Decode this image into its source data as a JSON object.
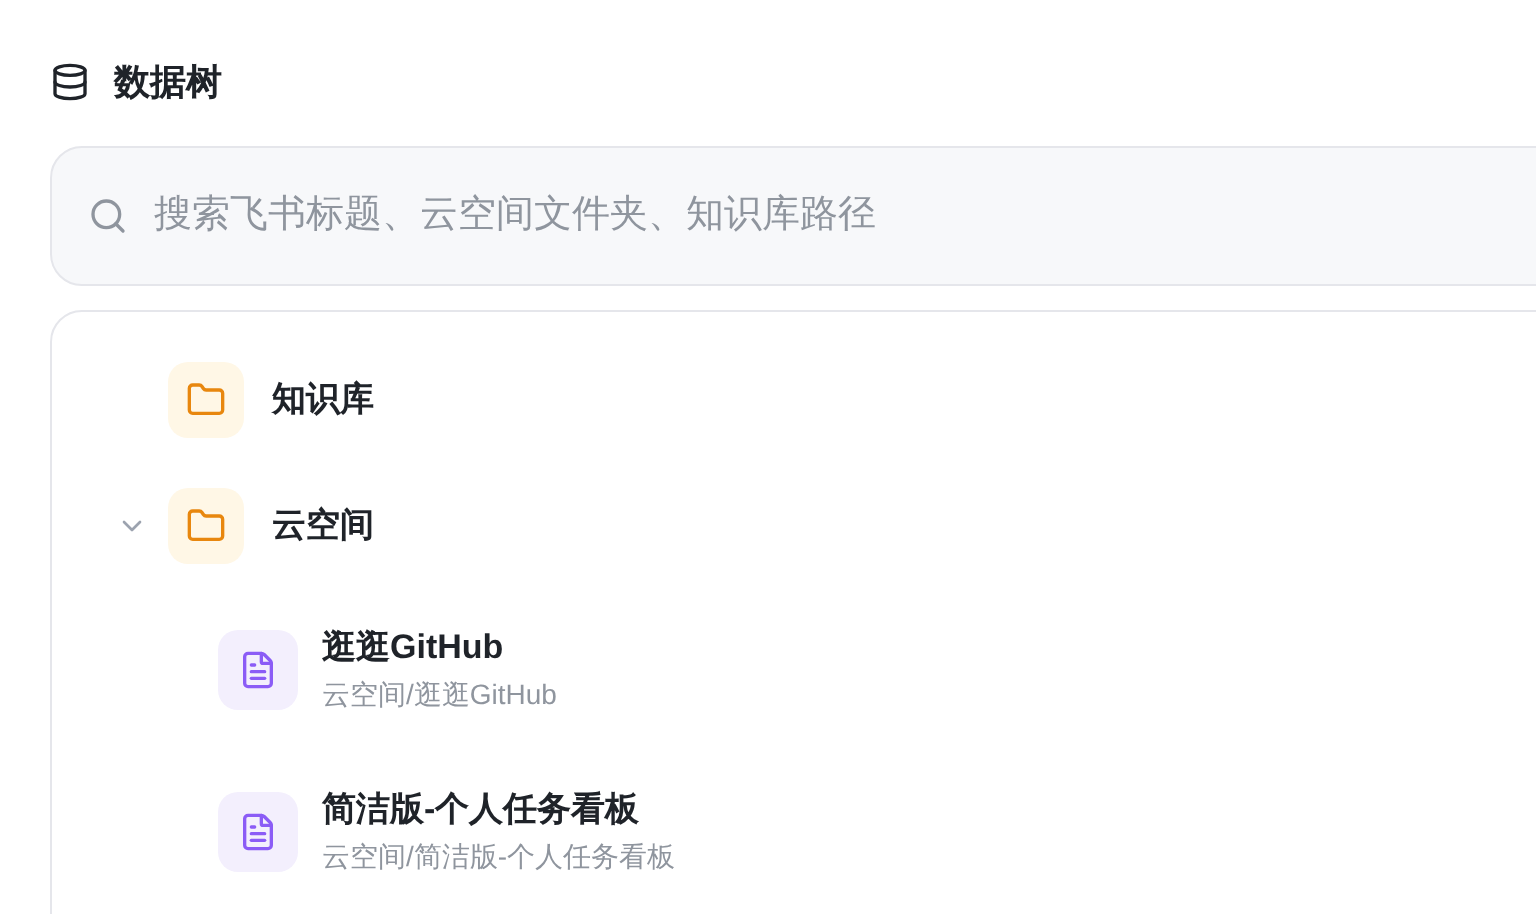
{
  "header": {
    "title": "数据树"
  },
  "search": {
    "placeholder": "搜索飞书标题、云空间文件夹、知识库路径"
  },
  "tree": [
    {
      "kind": "folder",
      "label": "知识库"
    },
    {
      "kind": "folder",
      "label": "云空间",
      "expanded": true,
      "children": [
        {
          "kind": "doc",
          "label": "逛逛GitHub",
          "path": "云空间/逛逛GitHub"
        },
        {
          "kind": "doc",
          "label": "简洁版-个人任务看板",
          "path": "云空间/简洁版-个人任务看板"
        }
      ]
    }
  ]
}
